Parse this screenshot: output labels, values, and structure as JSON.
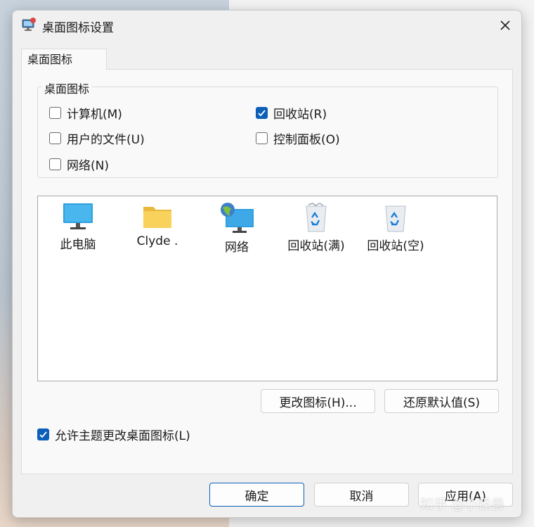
{
  "window": {
    "title": "桌面图标设置"
  },
  "tabs": [
    {
      "label": "桌面图标"
    }
  ],
  "group": {
    "label": "桌面图标",
    "checkboxes": [
      {
        "label": "计算机(M)",
        "checked": false
      },
      {
        "label": "回收站(R)",
        "checked": true
      },
      {
        "label": "用户的文件(U)",
        "checked": false
      },
      {
        "label": "控制面板(O)",
        "checked": false
      },
      {
        "label": "网络(N)",
        "checked": false
      }
    ]
  },
  "icons": [
    {
      "label": "此电脑",
      "icon": "monitor-icon"
    },
    {
      "label": "Clyde .",
      "icon": "folder-icon"
    },
    {
      "label": "网络",
      "icon": "network-globe-icon"
    },
    {
      "label": "回收站(满)",
      "icon": "recycle-bin-full-icon"
    },
    {
      "label": "回收站(空)",
      "icon": "recycle-bin-empty-icon"
    }
  ],
  "buttons": {
    "change_icon": "更改图标(H)...",
    "restore_default": "还原默认值(S)",
    "ok": "确定",
    "cancel": "取消",
    "apply": "应用(A)"
  },
  "allow_themes": {
    "label": "允许主题更改桌面图标(L)",
    "checked": true
  },
  "watermark": "知乎 @小怪兽",
  "colors": {
    "accent": "#0b5fb8"
  }
}
